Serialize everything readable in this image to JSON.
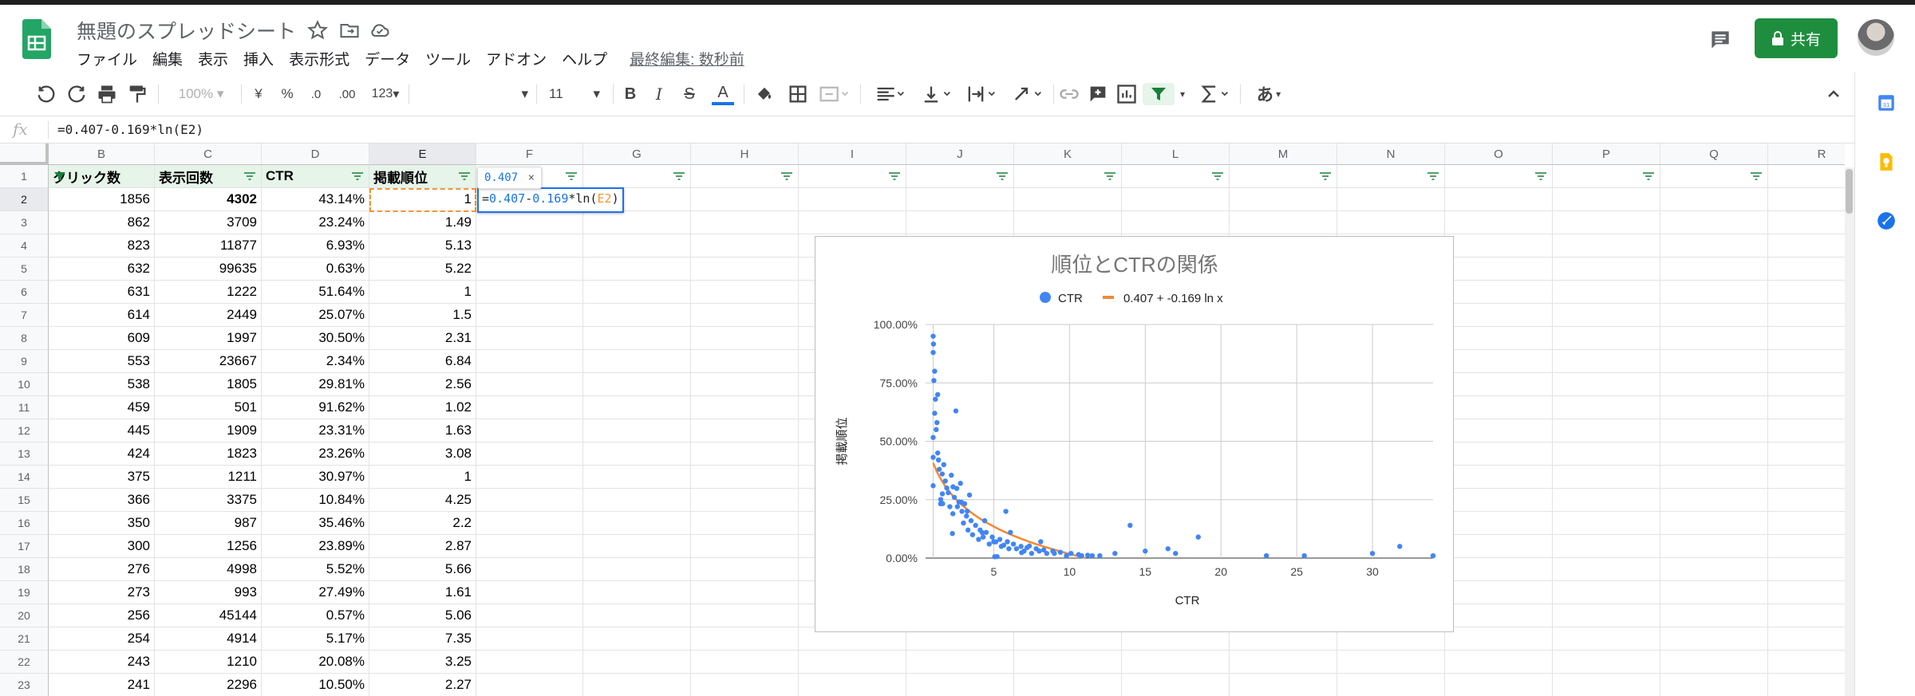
{
  "header": {
    "title": "無題のスプレッドシート",
    "menu": [
      "ファイル",
      "編集",
      "表示",
      "挿入",
      "表示形式",
      "データ",
      "ツール",
      "アドオン",
      "ヘルプ"
    ],
    "last_edit": "最終編集: 数秒前",
    "share_label": "共有"
  },
  "toolbar": {
    "zoom": "100%",
    "currency": "¥",
    "percent": "%",
    "dec_decrease": ".0",
    "dec_increase": ".00",
    "more_formats": "123",
    "font_size": "11",
    "bold": "B",
    "italic": "I",
    "strike": "S",
    "text_color": "A",
    "input_tools": "あ"
  },
  "formula_bar": {
    "fx": "fx",
    "formula": "=0.407-0.169*ln(E2)"
  },
  "columns": [
    "B",
    "C",
    "D",
    "E",
    "F",
    "G",
    "H",
    "I",
    "J",
    "K",
    "L",
    "M",
    "N",
    "O",
    "P",
    "Q",
    "R"
  ],
  "rows": [
    "1",
    "2",
    "3",
    "4",
    "5",
    "6",
    "7",
    "8",
    "9",
    "10",
    "11",
    "12",
    "13",
    "14",
    "15",
    "16",
    "17",
    "18",
    "19",
    "20",
    "21",
    "22",
    "23"
  ],
  "table_headers": [
    "クリック数",
    "表示回数",
    "CTR",
    "掲載順位"
  ],
  "table_rows": [
    [
      "1856",
      "4302",
      "43.14%",
      "1"
    ],
    [
      "862",
      "3709",
      "23.24%",
      "1.49"
    ],
    [
      "823",
      "11877",
      "6.93%",
      "5.13"
    ],
    [
      "632",
      "99635",
      "0.63%",
      "5.22"
    ],
    [
      "631",
      "1222",
      "51.64%",
      "1"
    ],
    [
      "614",
      "2449",
      "25.07%",
      "1.5"
    ],
    [
      "609",
      "1997",
      "30.50%",
      "2.31"
    ],
    [
      "553",
      "23667",
      "2.34%",
      "6.84"
    ],
    [
      "538",
      "1805",
      "29.81%",
      "2.56"
    ],
    [
      "459",
      "501",
      "91.62%",
      "1.02"
    ],
    [
      "445",
      "1909",
      "23.31%",
      "1.63"
    ],
    [
      "424",
      "1823",
      "23.26%",
      "3.08"
    ],
    [
      "375",
      "1211",
      "30.97%",
      "1"
    ],
    [
      "366",
      "3375",
      "10.84%",
      "4.25"
    ],
    [
      "350",
      "987",
      "35.46%",
      "2.2"
    ],
    [
      "300",
      "1256",
      "23.89%",
      "2.87"
    ],
    [
      "276",
      "4998",
      "5.52%",
      "5.66"
    ],
    [
      "273",
      "993",
      "27.49%",
      "1.61"
    ],
    [
      "256",
      "45144",
      "0.57%",
      "5.06"
    ],
    [
      "254",
      "4914",
      "5.17%",
      "7.35"
    ],
    [
      "243",
      "1210",
      "20.08%",
      "3.25"
    ],
    [
      "241",
      "2296",
      "10.50%",
      "2.27"
    ]
  ],
  "editing": {
    "cell_formula_parts": [
      "=",
      "0.407",
      "-",
      "0.169",
      "*ln(",
      "E2",
      ")"
    ],
    "tooltip": "0.407",
    "tooltip_close": "×"
  },
  "chart_data": {
    "type": "scatter",
    "title": "順位とCTRの関係",
    "xlabel": "CTR",
    "ylabel": "掲載順位",
    "xlim": [
      0.5,
      34
    ],
    "ylim": [
      0,
      1
    ],
    "x_ticks": [
      "5",
      "10",
      "15",
      "20",
      "25",
      "30"
    ],
    "y_ticks": [
      "0.00%",
      "25.00%",
      "50.00%",
      "75.00%",
      "100.00%"
    ],
    "legend_position": "top",
    "series": [
      {
        "name": "CTR",
        "color": "#4285f4",
        "x": [
          1,
          1.49,
          5.13,
          5.22,
          1,
          1.5,
          2.31,
          6.84,
          2.56,
          1.02,
          1.63,
          3.08,
          1,
          4.25,
          2.2,
          2.87,
          5.66,
          1.61,
          5.06,
          7.35,
          3.25,
          2.27,
          1,
          1,
          1.05,
          1.1,
          1.2,
          1.3,
          1.4,
          1.6,
          1.8,
          2.0,
          2.4,
          2.6,
          2.9,
          3.2,
          3.5,
          3.8,
          4.1,
          4.5,
          4.9,
          5.4,
          5.9,
          6.3,
          6.8,
          7.2,
          7.8,
          8.3,
          8.9,
          9.4,
          10.1,
          10.6,
          11.2,
          12.0,
          13.0,
          14.0,
          15.0,
          16.5,
          17.0,
          18.5,
          23.0,
          25.5,
          30.0,
          31.8,
          34.0,
          1.15,
          1.25,
          1.35,
          1.7,
          1.9,
          2.1,
          2.3,
          2.7,
          3.0,
          3.3,
          3.6,
          4.0,
          4.3,
          4.7,
          5.0,
          5.5,
          6.0,
          6.5,
          7.0,
          7.5,
          8.0,
          8.5,
          9.0,
          9.8,
          10.8,
          11.5,
          3.4,
          2.8,
          4.4,
          6.1,
          1.1,
          1.3,
          2.5,
          5.8,
          8.1
        ],
        "y": [
          0.4314,
          0.2324,
          0.0693,
          0.0063,
          0.5164,
          0.2507,
          0.305,
          0.0234,
          0.2981,
          0.9162,
          0.2331,
          0.2326,
          0.3097,
          0.1084,
          0.3546,
          0.2389,
          0.0552,
          0.2749,
          0.0057,
          0.0517,
          0.2008,
          0.105,
          0.95,
          0.88,
          0.76,
          0.62,
          0.55,
          0.45,
          0.38,
          0.36,
          0.33,
          0.28,
          0.26,
          0.22,
          0.2,
          0.18,
          0.16,
          0.14,
          0.12,
          0.11,
          0.09,
          0.08,
          0.07,
          0.06,
          0.05,
          0.045,
          0.04,
          0.035,
          0.03,
          0.025,
          0.02,
          0.015,
          0.012,
          0.01,
          0.02,
          0.14,
          0.03,
          0.04,
          0.02,
          0.09,
          0.01,
          0.01,
          0.02,
          0.05,
          0.01,
          0.68,
          0.58,
          0.42,
          0.4,
          0.3,
          0.22,
          0.19,
          0.24,
          0.15,
          0.12,
          0.1,
          0.08,
          0.09,
          0.06,
          0.07,
          0.05,
          0.04,
          0.04,
          0.03,
          0.02,
          0.03,
          0.02,
          0.02,
          0.01,
          0.01,
          0.01,
          0.27,
          0.32,
          0.16,
          0.11,
          0.8,
          0.7,
          0.63,
          0.2,
          0.07
        ]
      },
      {
        "name": "0.407 + -0.169 ln x",
        "color": "#f08a36",
        "type": "trend"
      }
    ]
  }
}
